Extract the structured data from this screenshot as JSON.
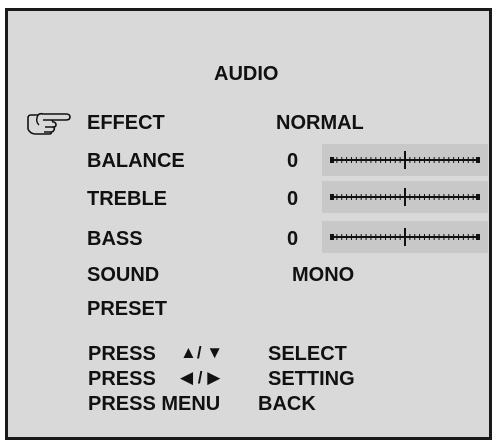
{
  "menu": {
    "title": "AUDIO",
    "items": [
      {
        "label": "EFFECT",
        "value": "NORMAL"
      },
      {
        "label": "BALANCE",
        "value": "0",
        "slider_level": 0.5
      },
      {
        "label": "TREBLE",
        "value": "0",
        "slider_level": 0.5
      },
      {
        "label": "BASS",
        "value": "0",
        "slider_level": 0.5
      },
      {
        "label": "SOUND",
        "value": "MONO"
      },
      {
        "label": "PRESET"
      }
    ],
    "selected_item": "EFFECT",
    "pointer_icon": "pointing-hand-icon"
  },
  "help": {
    "line1": {
      "prefix": "PRESS",
      "keys": "▲/ ▼",
      "action": "SELECT"
    },
    "line2": {
      "prefix": "PRESS",
      "keys": "◀ / ▶",
      "action": "SETTING"
    },
    "line3": {
      "prefix": "PRESS MENU",
      "action": "BACK"
    }
  },
  "colors": {
    "panel": "#d9d9d9",
    "frame": "#1a1a1a",
    "text": "#111111",
    "slider_bg": "#c8c8c8"
  }
}
